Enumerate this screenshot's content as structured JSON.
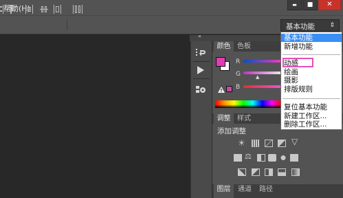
{
  "menubar": {
    "help": "帮助(H)"
  },
  "window_controls": {
    "minimize": "▬",
    "maximize": "■",
    "close": "✕"
  },
  "workspace": {
    "selected": "基本功能",
    "options": [
      "基本功能",
      "新增功能",
      "动感",
      "绘画",
      "摄影",
      "排版规则",
      "复位基本功能",
      "新建工作区...",
      "删除工作区..."
    ]
  },
  "panels": {
    "color_tabs": [
      "颜色",
      "色板"
    ],
    "channels": [
      "R",
      "G",
      "B"
    ],
    "adjust_tabs": [
      "调整",
      "样式"
    ],
    "adjust_title": "添加调整",
    "layer_tabs": [
      "图层",
      "通道",
      "路径"
    ]
  },
  "colors": {
    "foreground": "#e23bb5",
    "background": "#ffffff",
    "highlight": "#e44fb9",
    "selection": "#3a8ef4"
  },
  "icons": [
    "undo-history-icon",
    "play-icon",
    "tool-presets-icon",
    "gamut-warning-icon",
    "brightness-icon",
    "levels-icon",
    "curves-icon",
    "exposure-icon"
  ]
}
